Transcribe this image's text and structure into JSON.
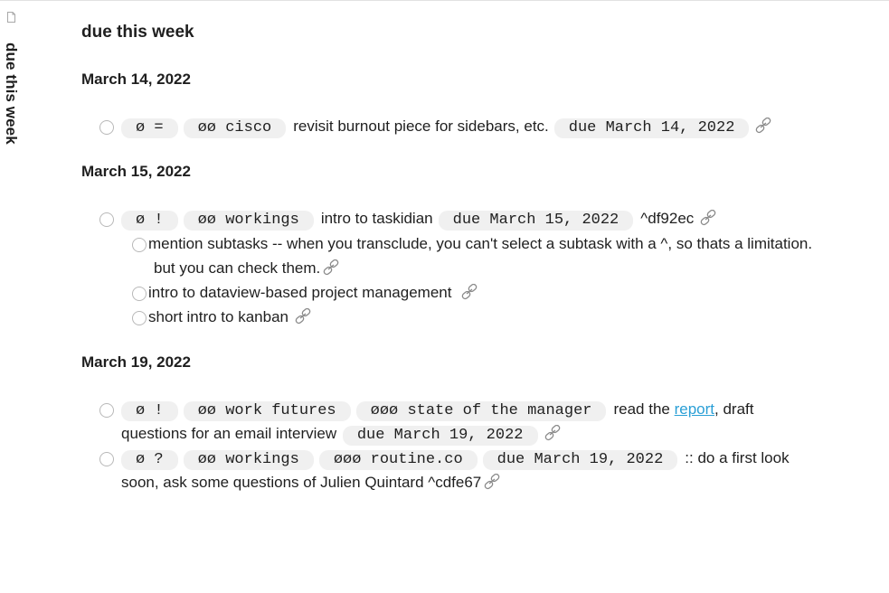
{
  "sidebar": {
    "title": "due this week"
  },
  "page": {
    "title": "due this week"
  },
  "groups": [
    {
      "date": "March 14, 2022",
      "tasks": [
        {
          "pills_pre": [
            "ø =",
            "øø cisco"
          ],
          "text": "revisit burnout piece for sidebars, etc.",
          "due": "due March 14, 2022"
        }
      ]
    },
    {
      "date": "March 15, 2022",
      "tasks": [
        {
          "pills_pre": [
            "ø !",
            "øø workings"
          ],
          "text": "intro to taskidian",
          "due": "due March 15, 2022",
          "suffix": "^df92ec",
          "subtasks": [
            {
              "text_line1": "mention subtasks -- when you transclude, you can't select a subtask with a ^, so thats a limitation.",
              "text_line2": "but you can check them."
            },
            {
              "text": "intro to dataview-based project management"
            },
            {
              "text": "short intro to kanban"
            }
          ]
        }
      ]
    },
    {
      "date": "March 19, 2022",
      "tasks": [
        {
          "pills_pre": [
            "ø !",
            "øø work futures",
            "øøø state of the manager"
          ],
          "text_a": "read the",
          "link": "report",
          "text_b": ", draft",
          "line2": "questions for an email interview",
          "due": "due March 19, 2022"
        },
        {
          "pills_pre": [
            "ø ?",
            "øø workings",
            "øøø routine.co",
            "due March 19, 2022"
          ],
          "text": ":: do a first look",
          "line2": "soon, ask some questions of Julien Quintard ^cdfe67"
        }
      ]
    }
  ],
  "icons": {
    "doc": "file-icon",
    "link": "chain-link-icon"
  },
  "colors": {
    "link": "#2a9fd6",
    "pill_bg": "#f0f0f0"
  }
}
